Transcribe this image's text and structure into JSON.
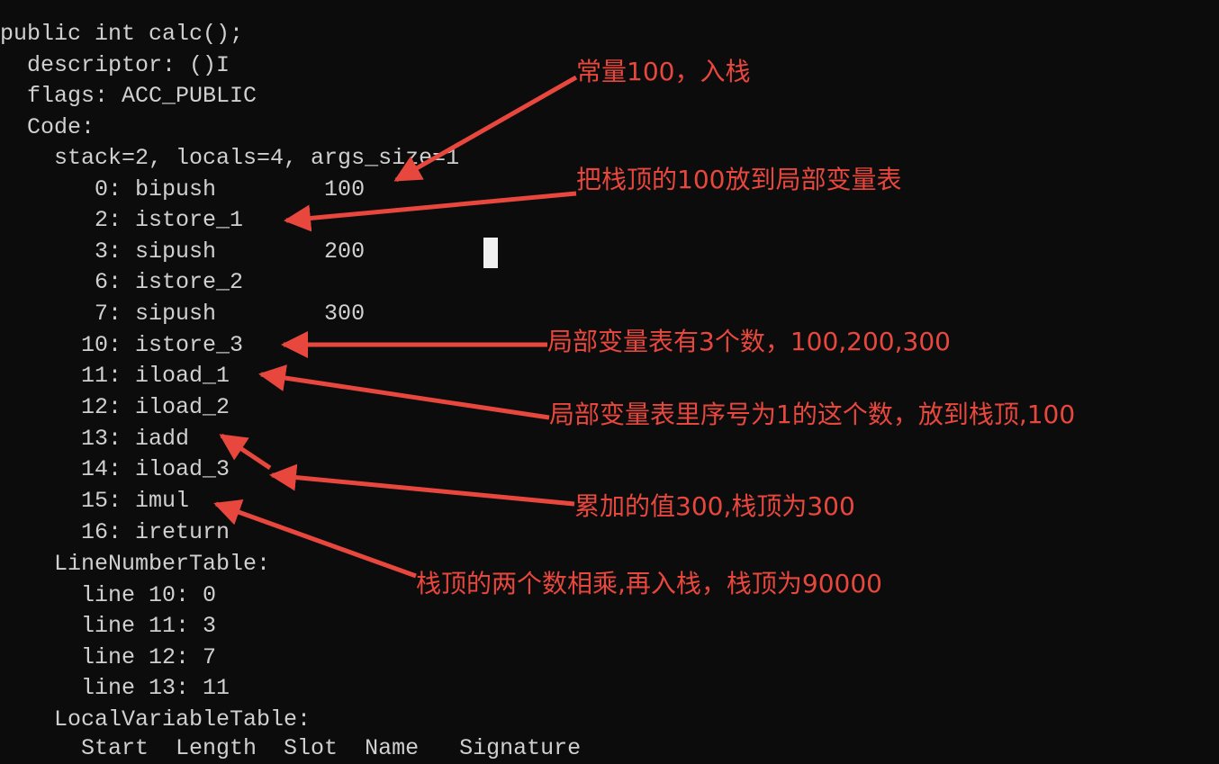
{
  "terminal": {
    "lines": [
      "public int calc();",
      "  descriptor: ()I",
      "  flags: ACC_PUBLIC",
      "  Code:",
      "    stack=2, locals=4, args_size=1",
      "       0: bipush        100",
      "       2: istore_1",
      "       3: sipush        200",
      "       6: istore_2",
      "       7: sipush        300",
      "      10: istore_3",
      "      11: iload_1",
      "      12: iload_2",
      "      13: iadd",
      "      14: iload_3",
      "      15: imul",
      "      16: ireturn",
      "    LineNumberTable:",
      "      line 10: 0",
      "      line 11: 3",
      "      line 12: 7",
      "      line 13: 11",
      "    LocalVariableTable:"
    ],
    "cut_off_line": "      Start  Length  Slot  Name   Signature"
  },
  "annotations": [
    "常量100，入栈",
    "把栈顶的100放到局部变量表",
    "局部变量表有3个数，100,200,300",
    "局部变量表里序号为1的这个数，放到栈顶,100",
    "累加的值300,栈顶为300",
    "栈顶的两个数相乘,再入栈，栈顶为90000"
  ],
  "colors": {
    "background": "#0c0c0c",
    "text": "#d0d0d0",
    "annotation": "#e8473d"
  }
}
